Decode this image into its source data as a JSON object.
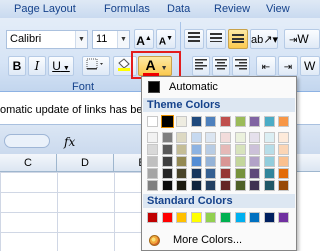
{
  "tabs": [
    "Page Layout",
    "Formulas",
    "Data",
    "Review",
    "View"
  ],
  "ribbon": {
    "font_name": "Calibri",
    "font_size": "11",
    "grow_font": "A",
    "shrink_font": "A",
    "bold": "B",
    "italic": "I",
    "underline": "U",
    "font_color_letter": "A",
    "font_group_label": "Font",
    "wrap_text_clip": "W",
    "merge_clip": "W"
  },
  "message_bar": "omatic update of links has been",
  "formula_bar": {
    "fx": "fx"
  },
  "columns": [
    "C",
    "D",
    "E"
  ],
  "palette": {
    "automatic_label": "Automatic",
    "theme_title": "Theme Colors",
    "standard_title": "Standard Colors",
    "more_colors_label": "More Colors...",
    "theme_colors": [
      [
        "#ffffff",
        "#000000",
        "#eeece1",
        "#1f497d",
        "#4f81bd",
        "#c0504d",
        "#9bbb59",
        "#8064a2",
        "#4bacc6",
        "#f79646"
      ],
      [
        "#f2f2f2",
        "#7f7f7f",
        "#ddd9c3",
        "#c6d9f0",
        "#dbe5f1",
        "#f2dcdb",
        "#ebf1dd",
        "#e5e0ec",
        "#dbeef3",
        "#fdeada"
      ],
      [
        "#d8d8d8",
        "#595959",
        "#c4bd97",
        "#8db3e2",
        "#b8cce4",
        "#e5b9b7",
        "#d7e3bc",
        "#ccc1d9",
        "#b7dde8",
        "#fbd5b5"
      ],
      [
        "#bfbfbf",
        "#3f3f3f",
        "#938953",
        "#548dd4",
        "#95b3d7",
        "#d99694",
        "#c3d69b",
        "#b2a2c7",
        "#92cddc",
        "#fac08f"
      ],
      [
        "#a5a5a5",
        "#262626",
        "#494429",
        "#17365d",
        "#366092",
        "#953734",
        "#76923c",
        "#5f497a",
        "#31859b",
        "#e36c09"
      ],
      [
        "#7f7f7f",
        "#0c0c0c",
        "#1d1b10",
        "#0f243e",
        "#244061",
        "#632423",
        "#4f6128",
        "#3f3151",
        "#205867",
        "#974806"
      ]
    ],
    "standard_colors": [
      "#c00000",
      "#ff0000",
      "#ffc000",
      "#ffff00",
      "#92d050",
      "#00b050",
      "#00b0f0",
      "#0070c0",
      "#002060",
      "#7030a0"
    ],
    "selected_theme_index": [
      0,
      1
    ]
  }
}
